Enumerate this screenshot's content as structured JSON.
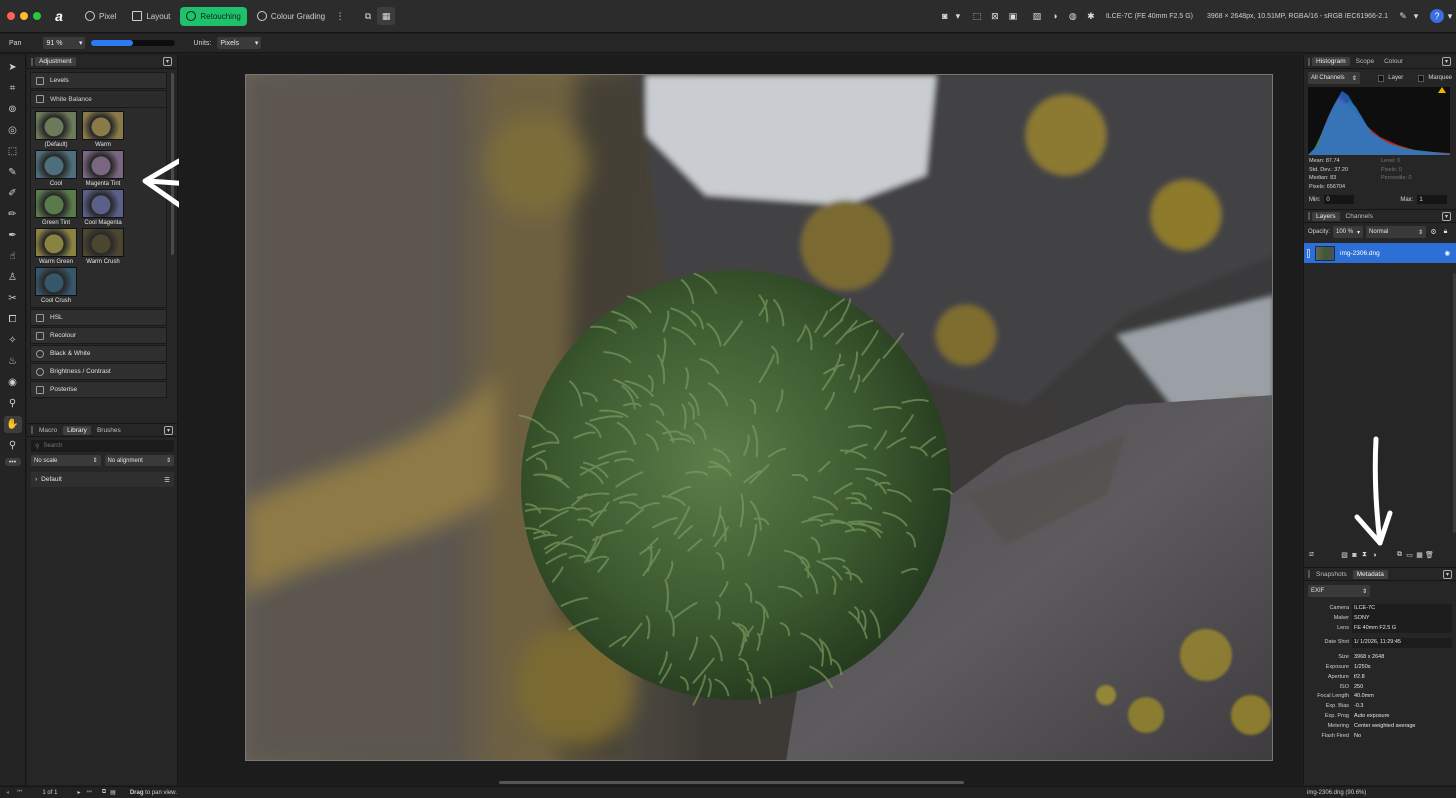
{
  "titlebar": {
    "personas": [
      {
        "label": "Pixel"
      },
      {
        "label": "Layout"
      },
      {
        "label": "Retouching"
      },
      {
        "label": "Colour Grading"
      }
    ],
    "doc_camera": "ILCE-7C (FE 40mm F2.5 G)",
    "doc_info": "3968 × 2648px, 10.51MP, RGBA/16 - sRGB IEC61966-2.1",
    "help": "?"
  },
  "context": {
    "tool_label": "Pan",
    "zoom": "91 %",
    "zoom_fraction": 0.5,
    "units_label": "Units:",
    "units_value": "Pixels"
  },
  "left_panel": {
    "tabs": [
      "Adjustment"
    ],
    "adjustments_top": [
      "Levels"
    ],
    "white_balance": {
      "title": "White Balance",
      "presets": [
        {
          "label": "(Default)",
          "color": "#6b7a58"
        },
        {
          "label": "Warm",
          "color": "#8a7a48"
        },
        {
          "label": "Cool",
          "color": "#4d6f7c"
        },
        {
          "label": "Magenta Tint",
          "color": "#7a6680"
        },
        {
          "label": "Green Tint",
          "color": "#5a7a4a"
        },
        {
          "label": "Cool Magenta",
          "color": "#59608a"
        },
        {
          "label": "Warm Green",
          "color": "#8a8240"
        },
        {
          "label": "Warm Crush",
          "color": "#4c4630"
        },
        {
          "label": "Cool Crush",
          "color": "#36566a"
        }
      ]
    },
    "adjustments_bottom": [
      "HSL",
      "Recolour",
      "Black & White",
      "Brightness / Contrast",
      "Posterise"
    ],
    "library": {
      "tabs": [
        "Macro",
        "Library",
        "Brushes"
      ],
      "search_placeholder": "Search",
      "scale": "No scale",
      "alignment": "No alignment",
      "category": "Default"
    }
  },
  "right_panel": {
    "histogram_tabs": [
      "Histogram",
      "Scope",
      "Colour"
    ],
    "channels": "All Channels",
    "layer_check": "Layer",
    "marquee_check": "Marquee",
    "stats_left": [
      "Mean: 87.74",
      "Std. Dev.: 37.20",
      "Median: 83",
      "Pixels: 656704"
    ],
    "stats_right": [
      "Level: 0",
      "Pixels: 0",
      "Percentile: 0"
    ],
    "min_label": "Min:",
    "min_value": "0",
    "max_label": "Max:",
    "max_value": "1",
    "layers_tabs": [
      "Layers",
      "Channels"
    ],
    "opacity_label": "Opacity:",
    "opacity_value": "100 %",
    "blend_mode": "Normal",
    "layer_name": "img-2306.dng",
    "meta_tabs": [
      "Snapshots",
      "Metadata"
    ],
    "meta_type": "EXIF",
    "metadata": [
      {
        "k": "Camera",
        "v": "ILCE-7C",
        "boxed": true
      },
      {
        "k": "Maker",
        "v": "SONY",
        "boxed": true
      },
      {
        "k": "Lens",
        "v": "FE 40mm F2.5 G",
        "boxed": true
      },
      {
        "k": "Date Shot",
        "v": "1/  1/2026,  11:29:45",
        "boxed": true,
        "gap": true
      },
      {
        "k": "Size",
        "v": "3968 x 2648",
        "boxed": false,
        "gap": true
      },
      {
        "k": "Exposure",
        "v": "1/250s",
        "boxed": false
      },
      {
        "k": "Aperture",
        "v": "f/2.8",
        "boxed": false
      },
      {
        "k": "ISO",
        "v": "250",
        "boxed": false
      },
      {
        "k": "Focal Length",
        "v": "40.0mm",
        "boxed": false
      },
      {
        "k": "Exp. Bias",
        "v": "-0.3",
        "boxed": false
      },
      {
        "k": "Exp. Prog",
        "v": "Auto exposure",
        "boxed": false
      },
      {
        "k": "Metering",
        "v": "Center weighted average",
        "boxed": false
      },
      {
        "k": "Flash Fired",
        "v": "No",
        "boxed": false
      }
    ]
  },
  "status": {
    "page": "1 of 1",
    "hint_bold": "Drag",
    "hint": " to pan view.",
    "file": "img-2306.dng (90.6%)"
  },
  "colors": {
    "accent_green": "#1fc26c",
    "selection_blue": "#2c6fd6",
    "panel": "#262626"
  }
}
